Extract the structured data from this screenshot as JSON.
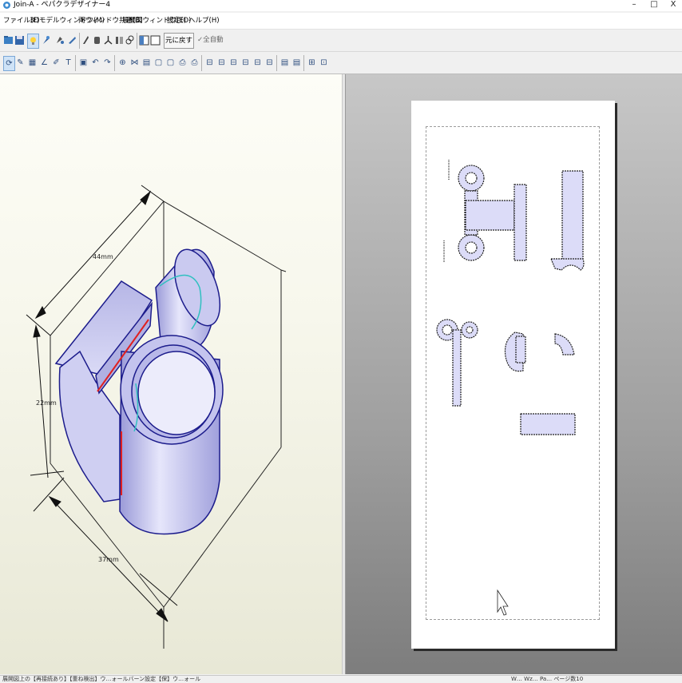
{
  "window": {
    "title": "Join-A - ペパクラデザイナー4",
    "minimize": "–",
    "maximize": "□",
    "close": "X"
  },
  "menu": [
    {
      "label": "ファイル(F)"
    },
    {
      "label": "3Dモデルウィンドウ(M)"
    },
    {
      "label": "両ウィンドウ共通(B)"
    },
    {
      "label": "展開図ウィンドウ(E)"
    },
    {
      "label": "設定(O)"
    },
    {
      "label": "ヘルプ(H)"
    }
  ],
  "toolbar1": {
    "undo_label": "元に戻す",
    "auto_label": "全自動"
  },
  "model_view": {
    "dim_width": "44mm",
    "dim_height": "22mm",
    "dim_depth": "37mm"
  },
  "status": {
    "left_text": "展開図上の【再接続あり】【重ね検出】ウ…ォールバーン設定【保】ウ…ォール",
    "right_text": "W… Wz… Pa… ページ数10"
  },
  "colors": {
    "model_fill": "#d6d6f2",
    "model_edge": "#1c1c8c",
    "cut_line": "#e02020",
    "part_fill": "#dcdcf8"
  },
  "icons": {
    "toolbar1": [
      "open-icon",
      "save-icon",
      "lightbulb-icon",
      "pin-icon",
      "paint-icon",
      "tool-icon",
      "knife-icon",
      "cup-icon",
      "person-icon",
      "column-icon",
      "link-icon",
      "window-left-icon",
      "window-right-icon"
    ],
    "toolbar2": [
      "rotate-icon",
      "pencil-icon",
      "select-icon",
      "slope-icon",
      "pen-icon",
      "text-icon",
      "image-icon",
      "undo-arrow-icon",
      "redo-arrow-icon",
      "join-icon",
      "split-icon",
      "grid-icon",
      "page-icon",
      "page2-icon",
      "print-icon",
      "printer-icon",
      "align1-icon",
      "align2-icon",
      "align3-icon",
      "align4-icon",
      "align5-icon",
      "align6-icon",
      "pdf-icon",
      "pdf2-icon",
      "layout-icon",
      "fit-icon"
    ]
  }
}
